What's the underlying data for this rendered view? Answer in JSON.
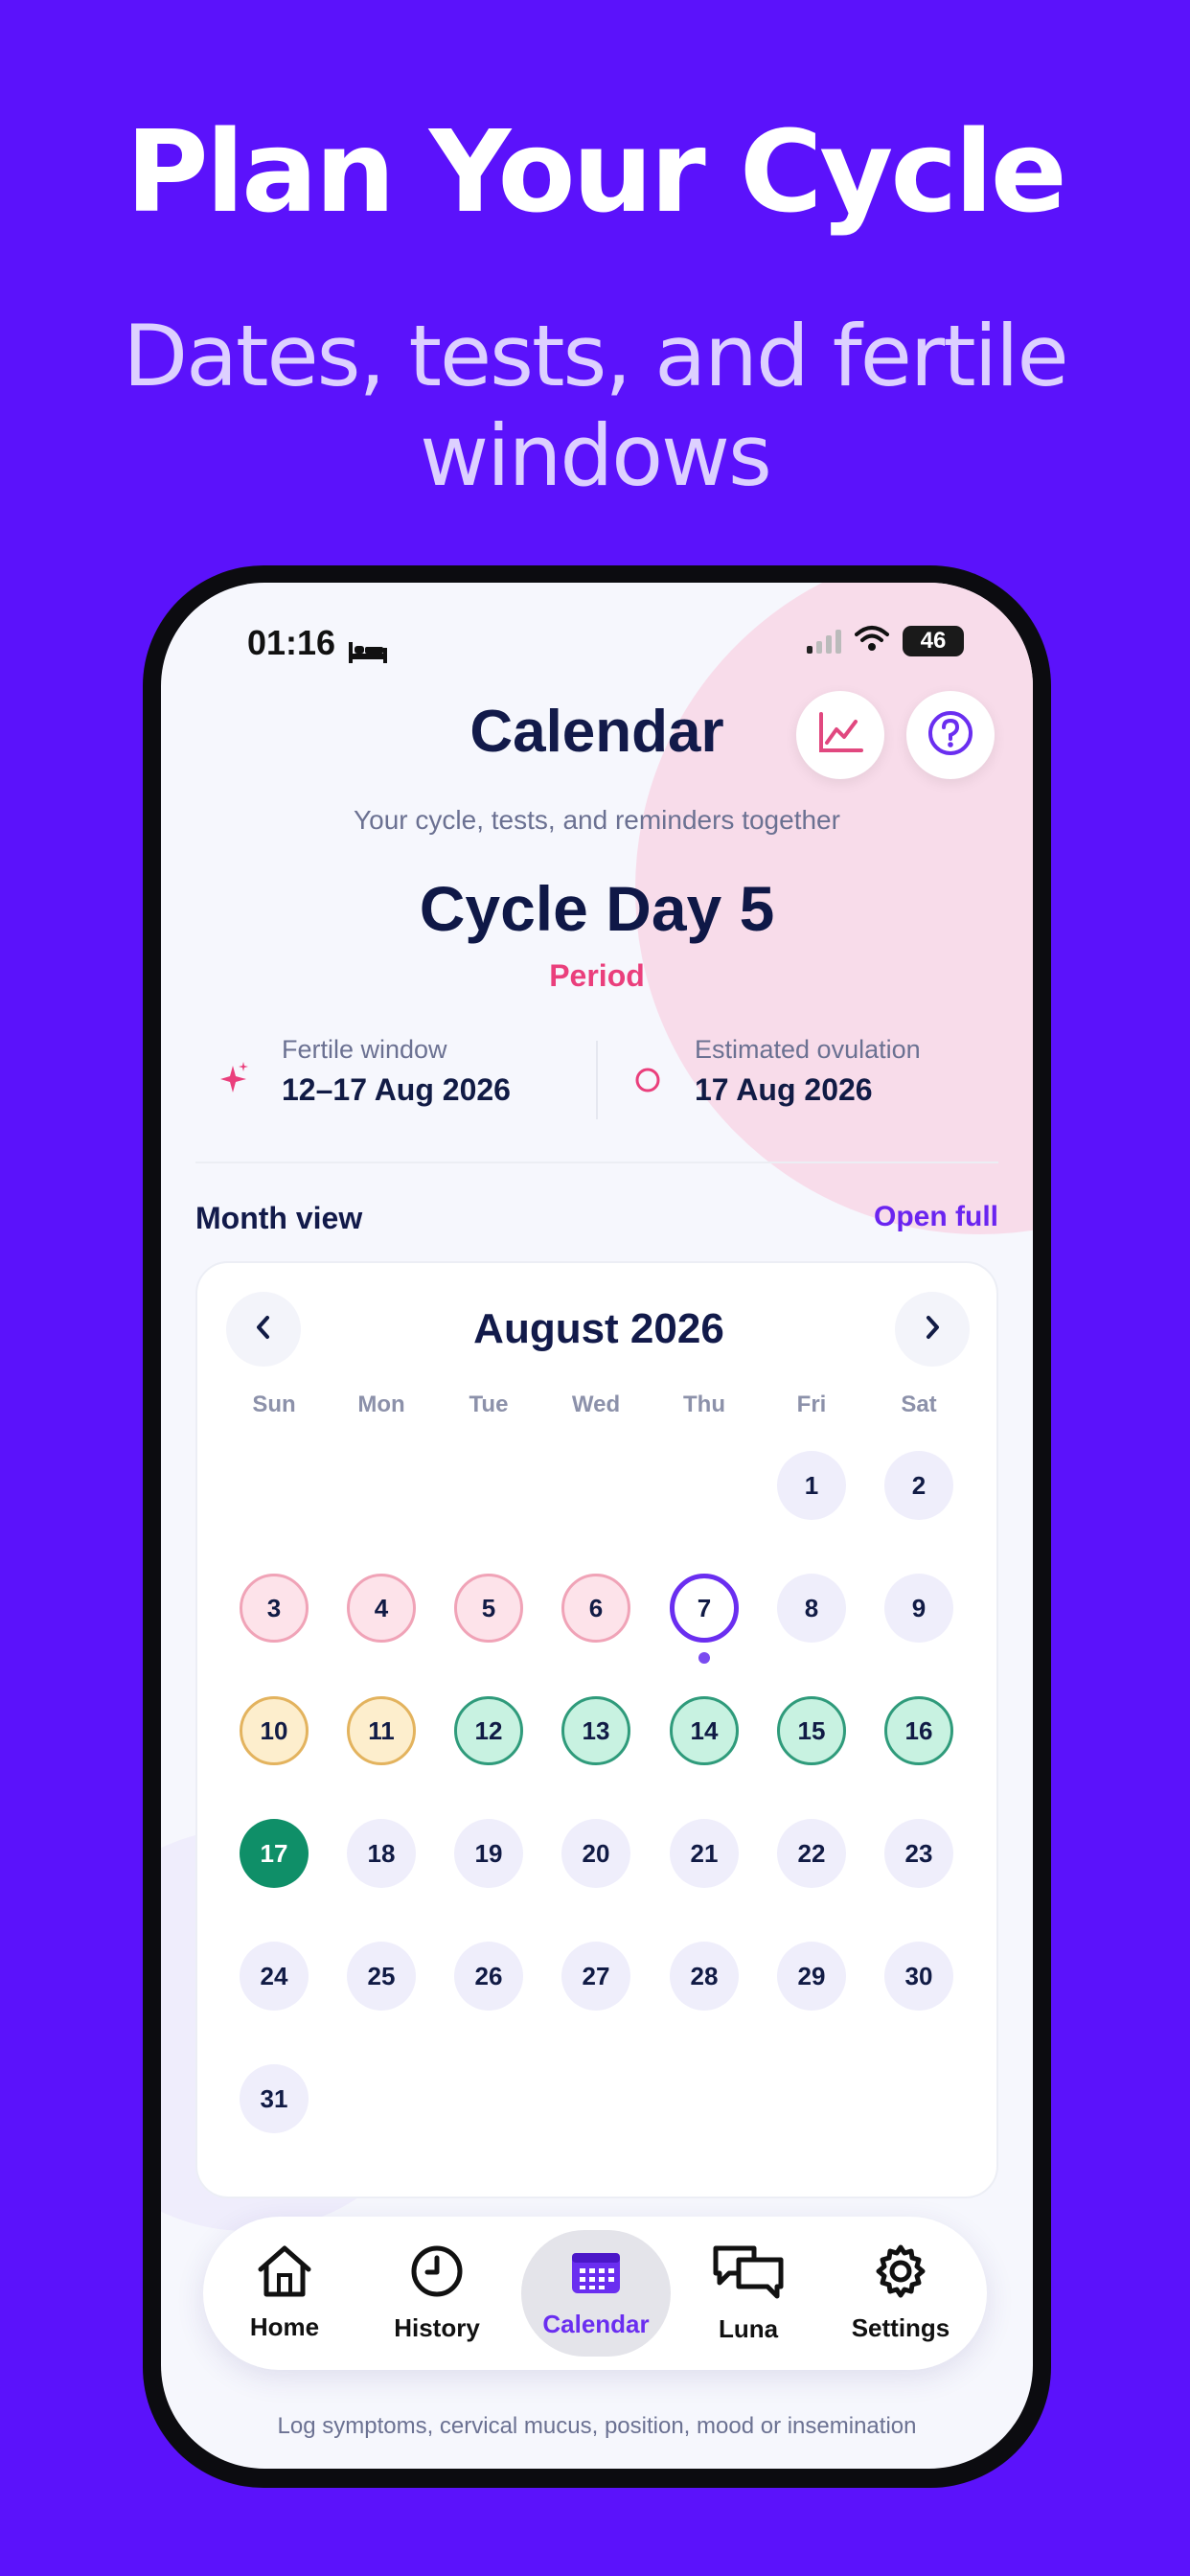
{
  "promo": {
    "title": "Plan Your Cycle",
    "subtitle": "Dates, tests, and fertile windows"
  },
  "status_bar": {
    "time": "01:16",
    "battery": "46"
  },
  "header": {
    "title": "Calendar",
    "subtitle": "Your cycle, tests, and reminders together"
  },
  "cycle": {
    "day_label": "Cycle Day 5",
    "phase": "Period"
  },
  "fertile_window": {
    "label": "Fertile window",
    "value": "12–17 Aug 2026"
  },
  "ovulation": {
    "label": "Estimated ovulation",
    "value": "17 Aug 2026"
  },
  "month_view": {
    "label": "Month view",
    "open_full": "Open full"
  },
  "calendar": {
    "title": "August 2026",
    "weekdays": [
      "Sun",
      "Mon",
      "Tue",
      "Wed",
      "Thu",
      "Fri",
      "Sat"
    ],
    "days": [
      {
        "n": "1",
        "type": "normal"
      },
      {
        "n": "2",
        "type": "normal"
      },
      {
        "n": "3",
        "type": "period"
      },
      {
        "n": "4",
        "type": "period"
      },
      {
        "n": "5",
        "type": "period"
      },
      {
        "n": "6",
        "type": "period"
      },
      {
        "n": "7",
        "type": "today"
      },
      {
        "n": "8",
        "type": "normal"
      },
      {
        "n": "9",
        "type": "normal"
      },
      {
        "n": "10",
        "type": "pre"
      },
      {
        "n": "11",
        "type": "pre"
      },
      {
        "n": "12",
        "type": "fertile"
      },
      {
        "n": "13",
        "type": "fertile"
      },
      {
        "n": "14",
        "type": "fertile"
      },
      {
        "n": "15",
        "type": "fertile"
      },
      {
        "n": "16",
        "type": "fertile"
      },
      {
        "n": "17",
        "type": "ovulation"
      },
      {
        "n": "18",
        "type": "normal"
      },
      {
        "n": "19",
        "type": "normal"
      },
      {
        "n": "20",
        "type": "normal"
      },
      {
        "n": "21",
        "type": "normal"
      },
      {
        "n": "22",
        "type": "normal"
      },
      {
        "n": "23",
        "type": "normal"
      },
      {
        "n": "24",
        "type": "normal"
      },
      {
        "n": "25",
        "type": "normal"
      },
      {
        "n": "26",
        "type": "normal"
      },
      {
        "n": "27",
        "type": "normal"
      },
      {
        "n": "28",
        "type": "normal"
      },
      {
        "n": "29",
        "type": "normal"
      },
      {
        "n": "30",
        "type": "normal"
      },
      {
        "n": "31",
        "type": "normal"
      }
    ]
  },
  "tabbar": {
    "home": "Home",
    "history": "History",
    "calendar": "Calendar",
    "luna": "Luna",
    "settings": "Settings"
  },
  "log_card": {
    "description": "Log symptoms, cervical mucus, position, mood or insemination"
  },
  "colors": {
    "background": "#5b12fb",
    "accent": "#6a2ef0",
    "period": "#ea3f7c",
    "fertile": "#2f9b7b",
    "ovulation": "#0f8f68"
  }
}
